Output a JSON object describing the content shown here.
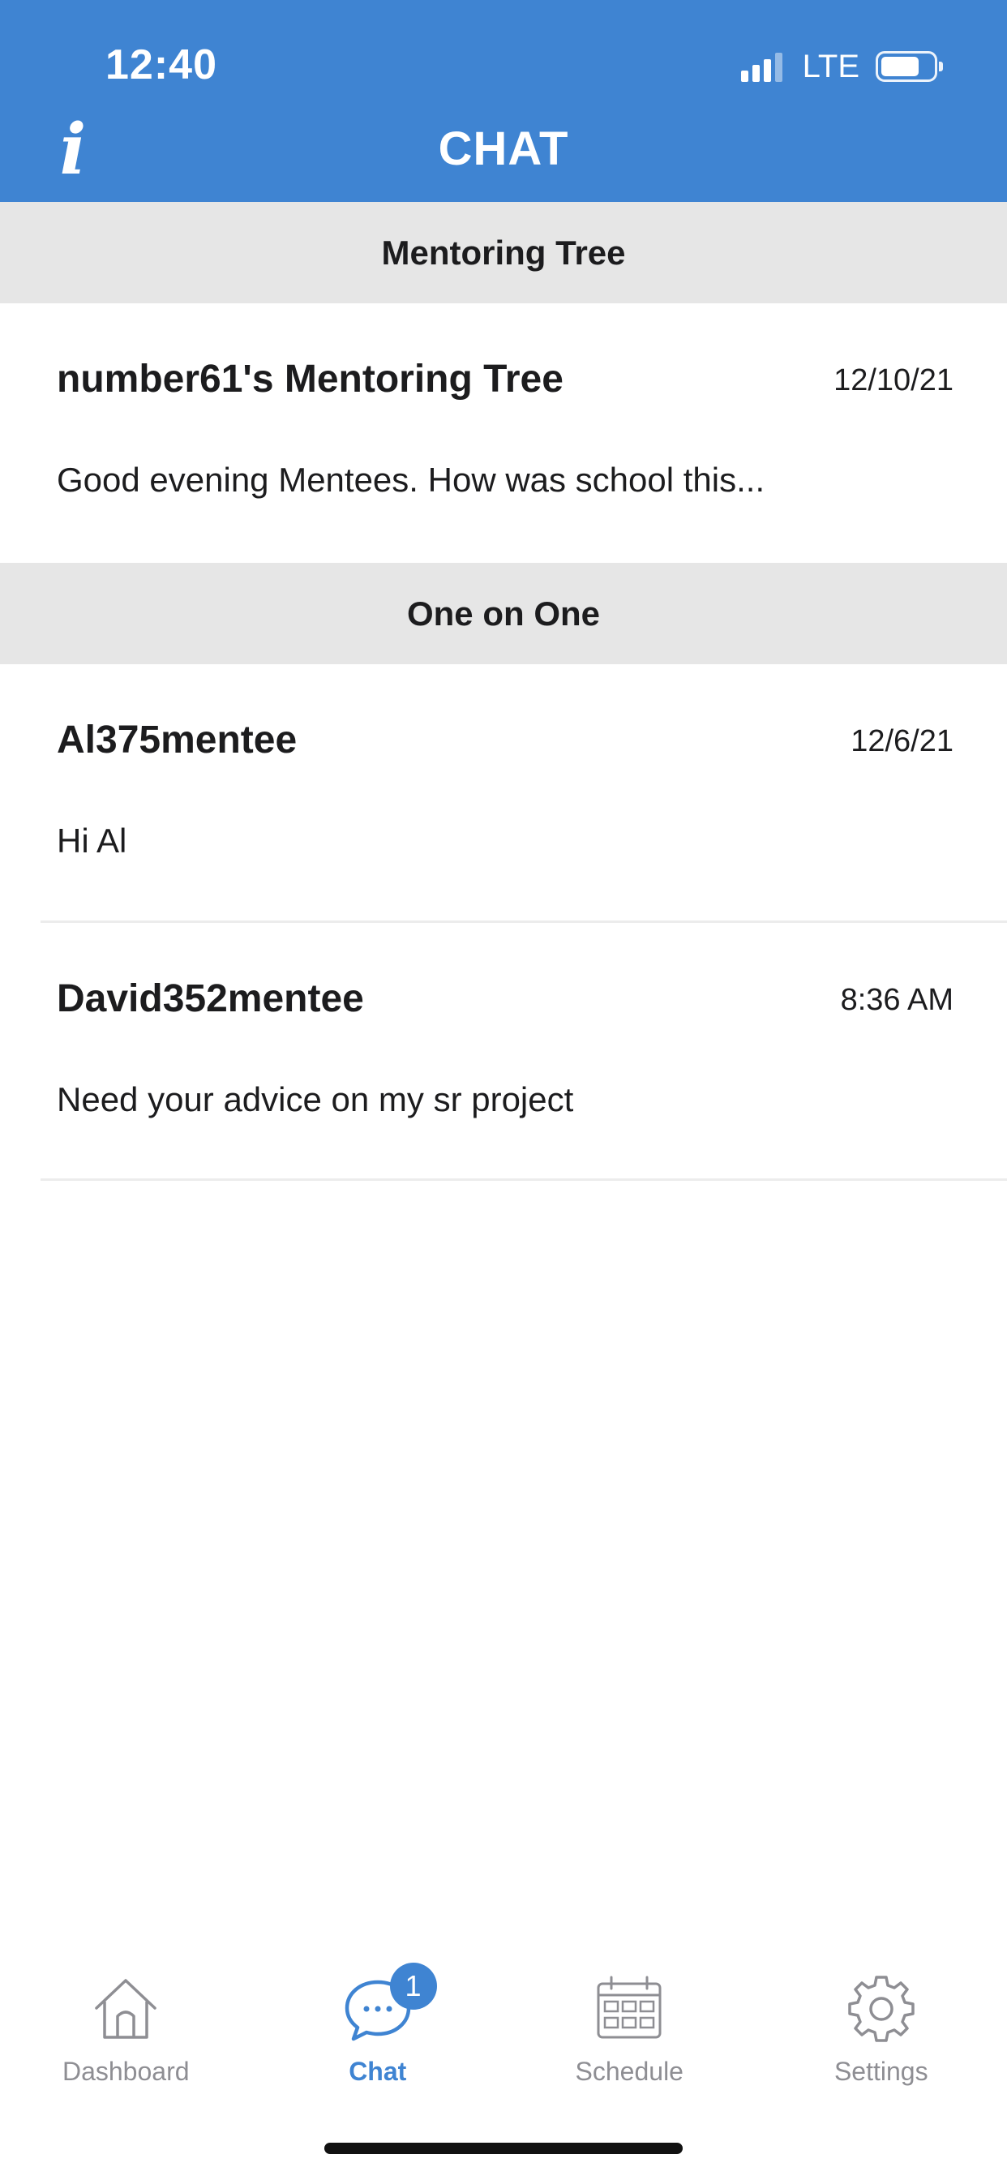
{
  "status_bar": {
    "time": "12:40",
    "network": "LTE",
    "signal_bars_active": 3,
    "signal_bars_total": 4,
    "battery_level": 0.65
  },
  "nav": {
    "title": "CHAT",
    "info_icon": "info-icon"
  },
  "sections": [
    {
      "header": "Mentoring Tree",
      "items": [
        {
          "name": "number61's Mentoring Tree",
          "time": "12/10/21",
          "preview": "Good evening Mentees. How was school this..."
        }
      ]
    },
    {
      "header": "One on One",
      "items": [
        {
          "name": "Al375mentee",
          "time": "12/6/21",
          "preview": "Hi Al"
        },
        {
          "name": "David352mentee",
          "time": "8:36 AM",
          "preview": "Need your advice on my sr project"
        }
      ]
    }
  ],
  "tab_bar": {
    "tabs": [
      {
        "label": "Dashboard",
        "icon": "home-icon",
        "active": false
      },
      {
        "label": "Chat",
        "icon": "chat-bubble-icon",
        "active": true,
        "badge": "1"
      },
      {
        "label": "Schedule",
        "icon": "calendar-icon",
        "active": false
      },
      {
        "label": "Settings",
        "icon": "gear-icon",
        "active": false
      }
    ]
  },
  "colors": {
    "brand": "#3f84d2",
    "section_header_bg": "#e6e6e6",
    "inactive_tab": "#8e8e93"
  }
}
